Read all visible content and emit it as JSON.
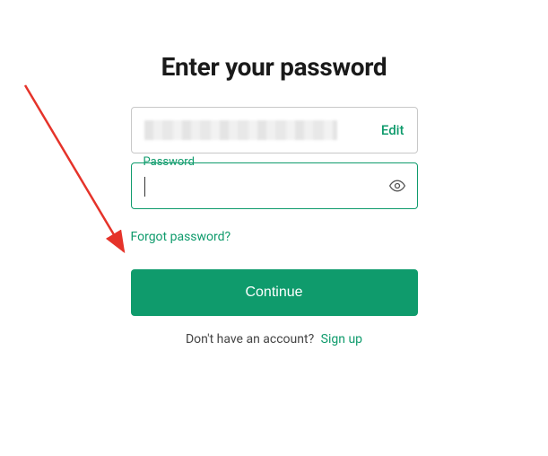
{
  "title": "Enter your password",
  "email": {
    "edit_label": "Edit"
  },
  "password": {
    "label": "Password",
    "value": ""
  },
  "forgot_label": "Forgot password?",
  "continue_label": "Continue",
  "signup": {
    "prompt": "Don't have an account?",
    "link": "Sign up"
  },
  "colors": {
    "accent": "#0f9b6c"
  }
}
